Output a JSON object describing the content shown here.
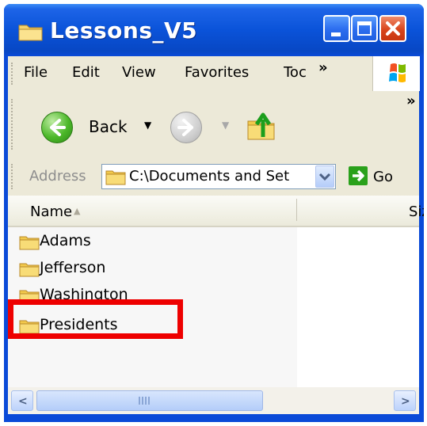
{
  "window": {
    "title": "Lessons_V5"
  },
  "menubar": {
    "items": [
      "File",
      "Edit",
      "View",
      "Favorites",
      "Toc"
    ]
  },
  "toolbar": {
    "back_label": "Back"
  },
  "addressbar": {
    "label": "Address",
    "path": "C:\\Documents and Set",
    "go_label": "Go"
  },
  "columns": {
    "name": "Name",
    "size": "Siz"
  },
  "files": [
    {
      "name": "Adams",
      "icon": "folder-icon"
    },
    {
      "name": "Jefferson",
      "icon": "folder-icon"
    },
    {
      "name": "Washington",
      "icon": "folder-icon"
    },
    {
      "name": "Presidents",
      "icon": "folder-icon"
    }
  ],
  "colors": {
    "titlebar": "#0a53d9",
    "highlight_box": "#ee0000",
    "chrome": "#ece9d8"
  }
}
